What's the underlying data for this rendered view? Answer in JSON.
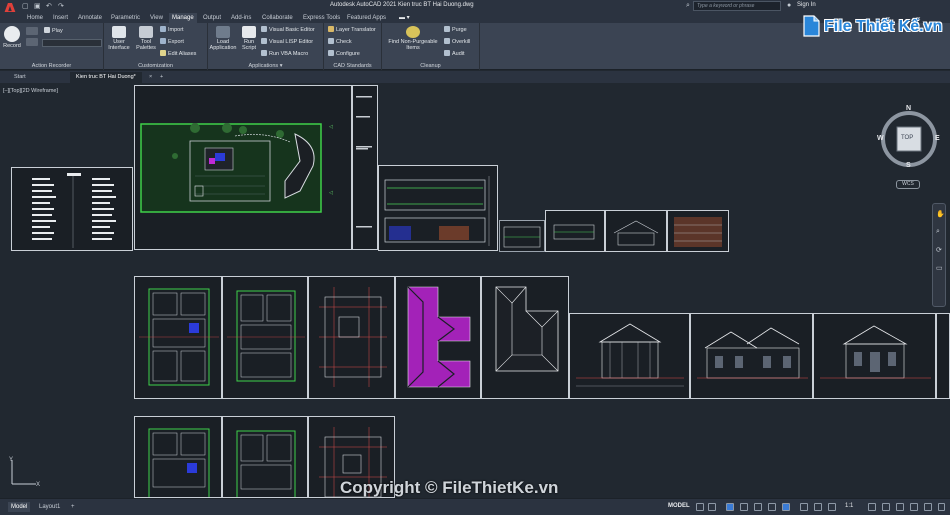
{
  "app": {
    "title": "Autodesk AutoCAD 2021   Kien truc BT Hai Duong.dwg",
    "logo_letter": "A",
    "search_placeholder": "Type a keyword or phrase",
    "sign_in": "Sign In"
  },
  "ribbon_tabs": [
    "Home",
    "Insert",
    "Annotate",
    "Parametric",
    "View",
    "Manage",
    "Output",
    "Add-ins",
    "Collaborate",
    "Express Tools",
    "Featured Apps"
  ],
  "active_tab": "Manage",
  "ribbon": {
    "action_recorder": {
      "label": "Action Recorder",
      "record": "Record",
      "play": "Play"
    },
    "customization": {
      "label": "Customization",
      "user_interface": "User Interface",
      "tool_palettes": "Tool Palettes",
      "import": "Import",
      "export": "Export",
      "edit_aliases": "Edit Aliases"
    },
    "applications": {
      "label": "Applications",
      "load_application": "Load Application",
      "run_script": "Run Script",
      "vbe": "Visual Basic Editor",
      "vlisp": "Visual LISP Editor",
      "vba": "Run VBA Macro"
    },
    "cad_standards": {
      "label": "CAD Standards",
      "layer_translator": "Layer Translator",
      "check": "Check",
      "configure": "Configure"
    },
    "cleanup": {
      "label": "Cleanup",
      "find": "Find Non-Purgeable Items",
      "purge": "Purge",
      "overkill": "Overkill",
      "audit": "Audit"
    }
  },
  "file_tabs": [
    "Start",
    "Kien truc BT Hai Duong*"
  ],
  "viewport_label": "[–][Top][2D Wireframe]",
  "viewcube": {
    "n": "N",
    "s": "S",
    "e": "E",
    "w": "W",
    "top": "TOP",
    "wcs": "WCS"
  },
  "watermark": "Copyright © FileThietKe.vn",
  "brand": "File Thiết Kế.vn",
  "status": {
    "layouts": [
      "Model",
      "Layout1"
    ],
    "active_layout": "Model",
    "space": "MODEL",
    "scale": "1:1"
  },
  "colors": {
    "accent": "#2a86d9",
    "background": "#212830",
    "ribbon": "#3b4453",
    "magenta": "#c02ad6"
  }
}
